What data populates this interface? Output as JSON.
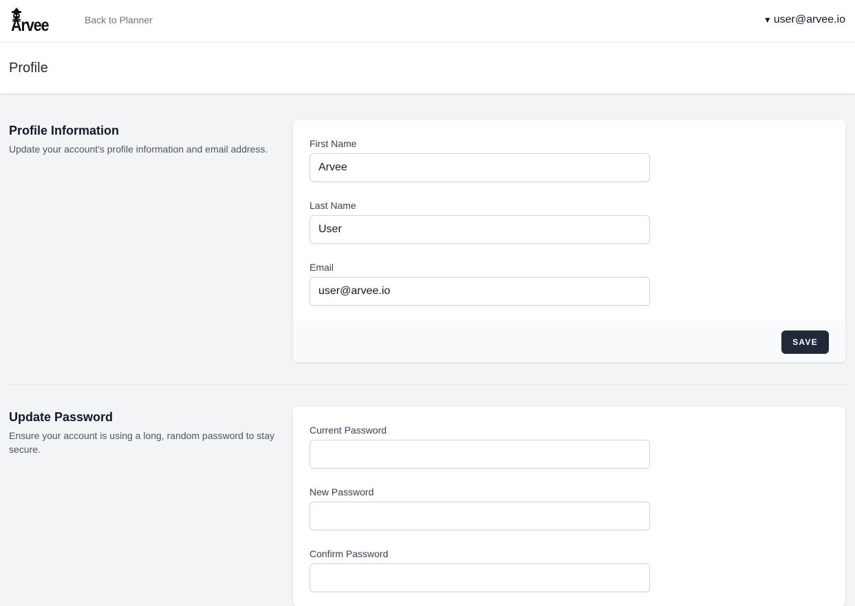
{
  "topnav": {
    "logo_text": "Arvee",
    "back_link": "Back to Planner",
    "user_email": "user@arvee.io",
    "caret_icon": "▼"
  },
  "header": {
    "title": "Profile"
  },
  "profile_info": {
    "title": "Profile Information",
    "description": "Update your account's profile information and email address.",
    "fields": [
      {
        "label": "First Name",
        "value": "Arvee"
      },
      {
        "label": "Last Name",
        "value": "User"
      },
      {
        "label": "Email",
        "value": "user@arvee.io"
      }
    ],
    "save_label": "SAVE"
  },
  "update_password": {
    "title": "Update Password",
    "description": "Ensure your account is using a long, random password to stay secure.",
    "fields": [
      {
        "label": "Current Password",
        "value": ""
      },
      {
        "label": "New Password",
        "value": ""
      },
      {
        "label": "Confirm Password",
        "value": ""
      }
    ]
  },
  "colors": {
    "page_bg": "#f3f4f6",
    "button_bg": "#1f2937",
    "footer_bg": "#f9fafb"
  }
}
